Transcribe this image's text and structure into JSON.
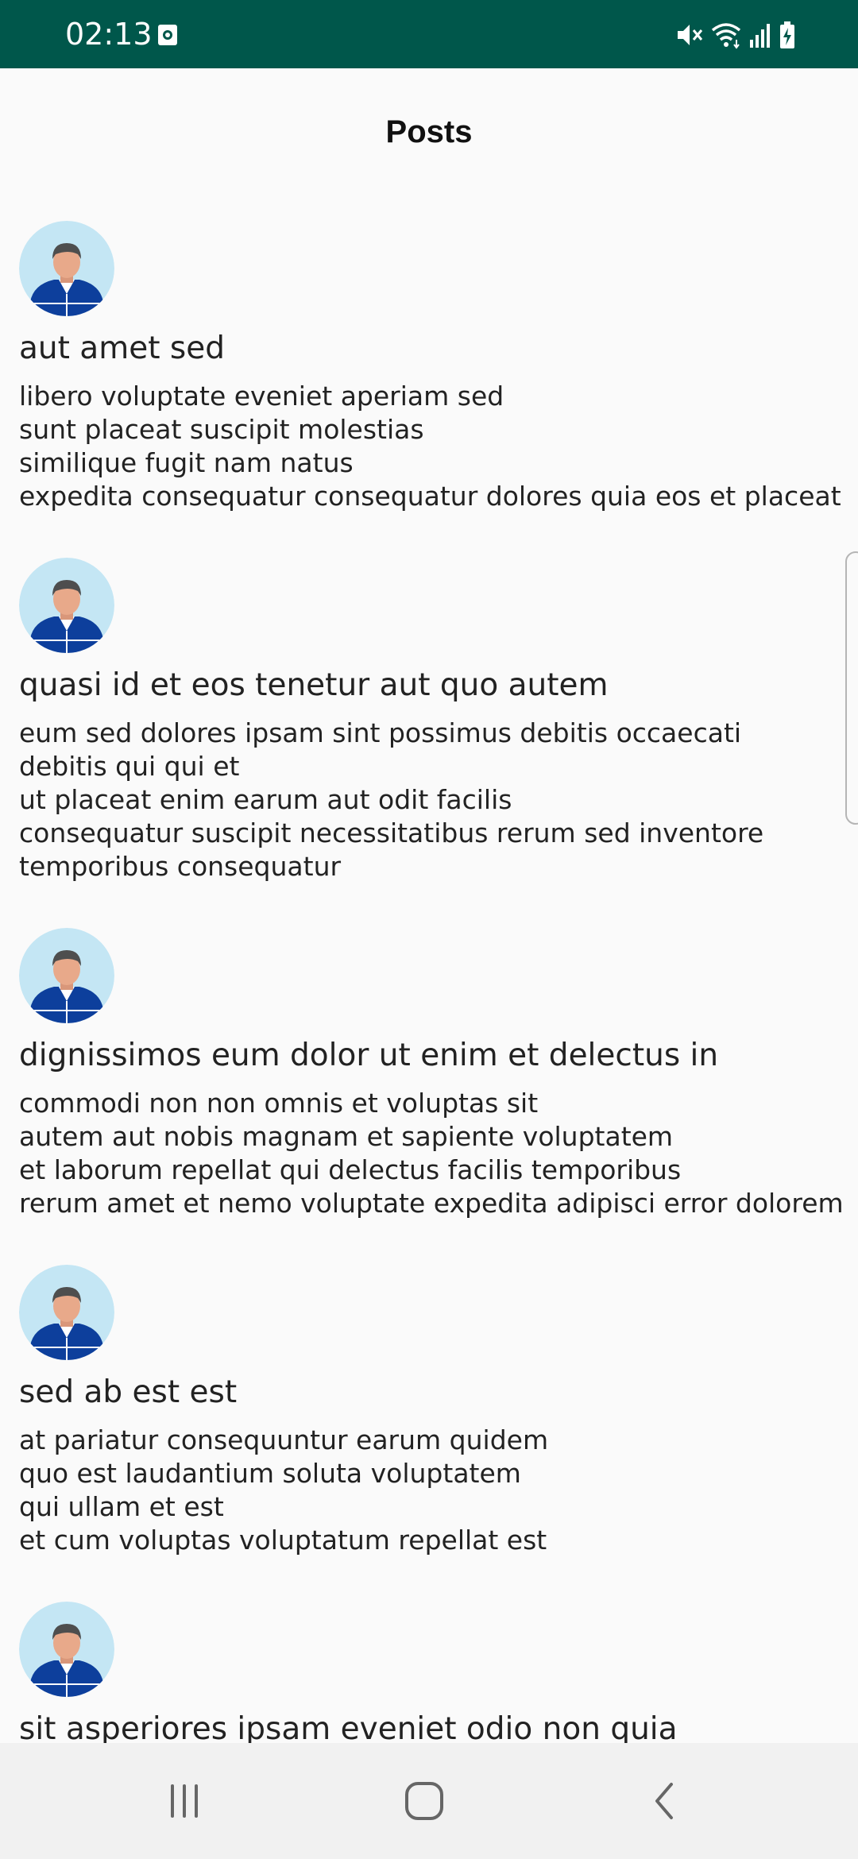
{
  "status_bar": {
    "time": "02:13",
    "icons": [
      "notification-icon",
      "mute-icon",
      "wifi-icon",
      "signal-icon",
      "battery-charging-icon"
    ]
  },
  "header": {
    "title": "Posts"
  },
  "posts": [
    {
      "title": "aut amet sed",
      "body_lines": [
        "libero voluptate eveniet aperiam sed",
        "sunt placeat suscipit molestias",
        "similique fugit nam natus",
        "expedita consequatur consequatur dolores quia eos et placeat"
      ]
    },
    {
      "title": "quasi id et eos tenetur aut quo autem",
      "body_lines": [
        "eum sed dolores ipsam sint possimus debitis occaecati",
        "debitis qui qui et",
        "ut placeat enim earum aut odit facilis",
        "consequatur suscipit necessitatibus rerum sed inventore",
        "temporibus consequatur"
      ]
    },
    {
      "title": "dignissimos eum dolor ut enim et delectus in",
      "body_lines": [
        "commodi non non omnis et voluptas sit",
        "autem aut nobis magnam et sapiente voluptatem",
        "et laborum repellat qui delectus facilis temporibus",
        "rerum amet et nemo voluptate expedita adipisci error dolorem"
      ]
    },
    {
      "title": "sed ab est est",
      "body_lines": [
        "at pariatur consequuntur earum quidem",
        "quo est laudantium soluta voluptatem",
        "qui ullam et est",
        "et cum voluptas voluptatum repellat est"
      ]
    },
    {
      "title": "sit asperiores ipsam eveniet odio non quia",
      "body_lines": []
    }
  ],
  "nav_bar": {
    "buttons": [
      "recent-apps-icon",
      "home-icon",
      "back-icon"
    ]
  },
  "colors": {
    "status_bar_bg": "#00574b",
    "background": "#fafafa",
    "nav_bar_bg": "#f1f1f1",
    "text": "#222222",
    "avatar_bg": "#c4e6f4",
    "jacket": "#0d3f9c"
  }
}
